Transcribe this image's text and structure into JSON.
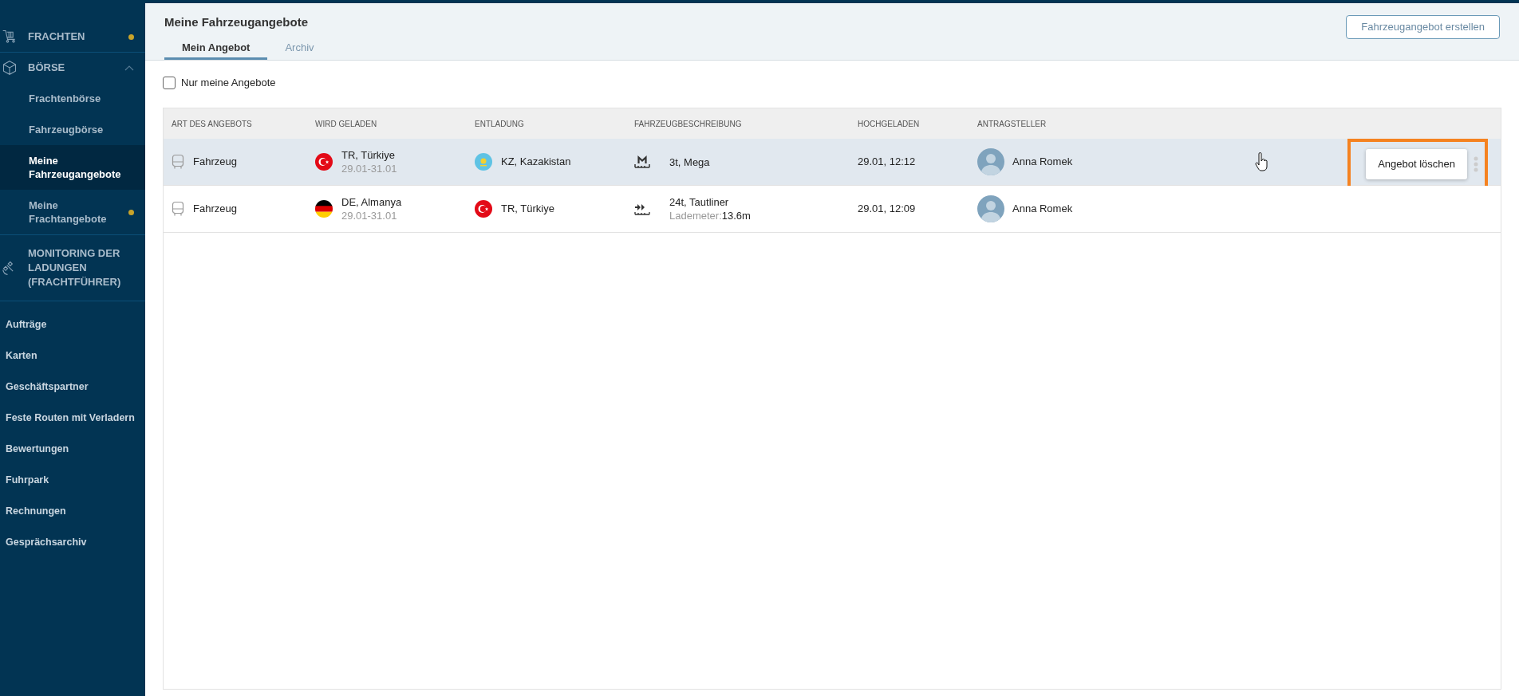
{
  "sidebar": {
    "sections": [
      {
        "label": "FRACHTEN",
        "dot": true,
        "expanded": false
      },
      {
        "label": "BÖRSE",
        "dot": false,
        "expanded": true,
        "children": [
          {
            "label": "Frachtenbörse",
            "selected": false,
            "dot": false
          },
          {
            "label": "Fahrzeugbörse",
            "selected": false,
            "dot": false
          },
          {
            "label": "Meine Fahrzeugangebote",
            "selected": true,
            "dot": false
          },
          {
            "label": "Meine Frachtangebote",
            "selected": false,
            "dot": true
          }
        ]
      },
      {
        "label": "MONITORING DER LADUNGEN (FRACHTFÜHRER)",
        "dot": false,
        "expanded": false
      }
    ],
    "links": [
      "Aufträge",
      "Karten",
      "Geschäftspartner",
      "Feste Routen mit Verladern",
      "Bewertungen",
      "Fuhrpark",
      "Rechnungen",
      "Gesprächsarchiv"
    ]
  },
  "header": {
    "title": "Meine Fahrzeugangebote",
    "button": "Fahrzeugangebot erstellen",
    "tabs": [
      {
        "label": "Mein Angebot",
        "selected": true
      },
      {
        "label": "Archiv",
        "selected": false
      }
    ]
  },
  "filter": {
    "label": "Nur meine Angebote",
    "checked": false
  },
  "table": {
    "columns": [
      "ART DES ANGEBOTS",
      "WIRD GELADEN",
      "ENTLADUNG",
      "FAHRZEUGBESCHREIBUNG",
      "HOCHGELADEN",
      "ANTRAGSTELLER"
    ],
    "rows": [
      {
        "selected": true,
        "type": "Fahrzeug",
        "loading": {
          "kind": "turkey",
          "place": "TR, Türkiye",
          "dates": "29.01-31.01"
        },
        "unloading": {
          "kind": "kazakhstan",
          "place": "KZ, Kazakistan"
        },
        "vehicle": {
          "kind": "mega",
          "text": "3t, Mega"
        },
        "uploaded": "29.01, 12:12",
        "requester": "Anna Romek",
        "action": "Angebot löschen"
      },
      {
        "selected": false,
        "type": "Fahrzeug",
        "loading": {
          "kind": "germany",
          "place": "DE, Almanya",
          "dates": "29.01-31.01"
        },
        "unloading": {
          "kind": "turkey",
          "place": "TR, Türkiye"
        },
        "vehicle": {
          "kind": "tautliner",
          "text": "24t, Tautliner",
          "meter_label": "Lademeter:",
          "meter_value": "13.6m"
        },
        "uploaded": "29.01, 12:09",
        "requester": "Anna Romek"
      }
    ]
  }
}
